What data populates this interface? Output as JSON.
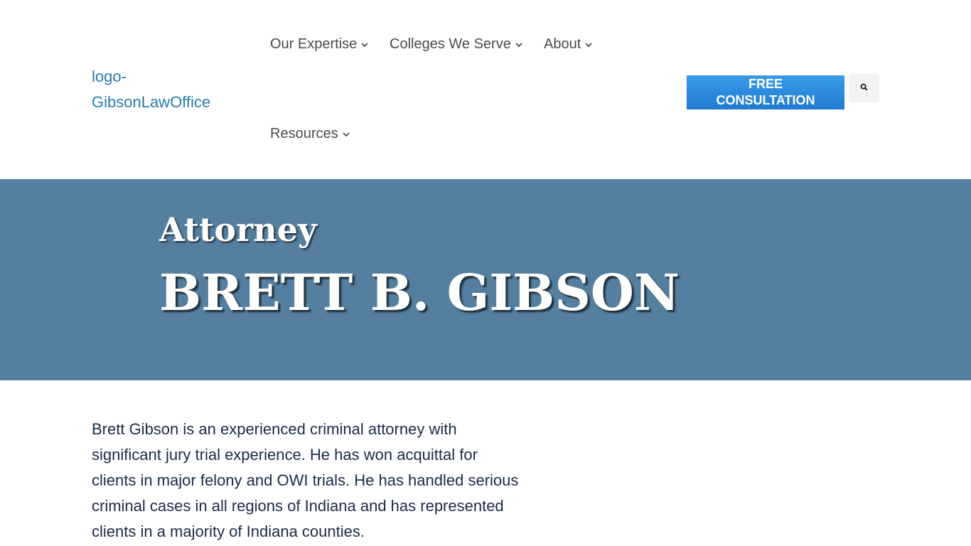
{
  "header": {
    "logo_alt": "logo-GibsonLawOffice",
    "nav": [
      {
        "label": "Our Expertise"
      },
      {
        "label": "Colleges We Serve"
      },
      {
        "label": "About"
      },
      {
        "label": "Resources"
      }
    ],
    "cta_line1": "FREE",
    "cta_line2": "CONSULTATION",
    "search_icon": "search-icon"
  },
  "hero": {
    "subtitle": "Attorney",
    "title": "BRETT B. GIBSON",
    "background": "#557f9f"
  },
  "bio": {
    "text": "Brett Gibson is an experienced criminal attorney with significant jury trial experience. He has won acquittal for clients in major felony and OWI trials. He has handled serious criminal cases in all regions of Indiana and has represented clients in a majority of Indiana counties."
  },
  "colors": {
    "accent": "#1f7ad1",
    "link": "#2a7cab",
    "body_text": "#1b2a4a"
  }
}
